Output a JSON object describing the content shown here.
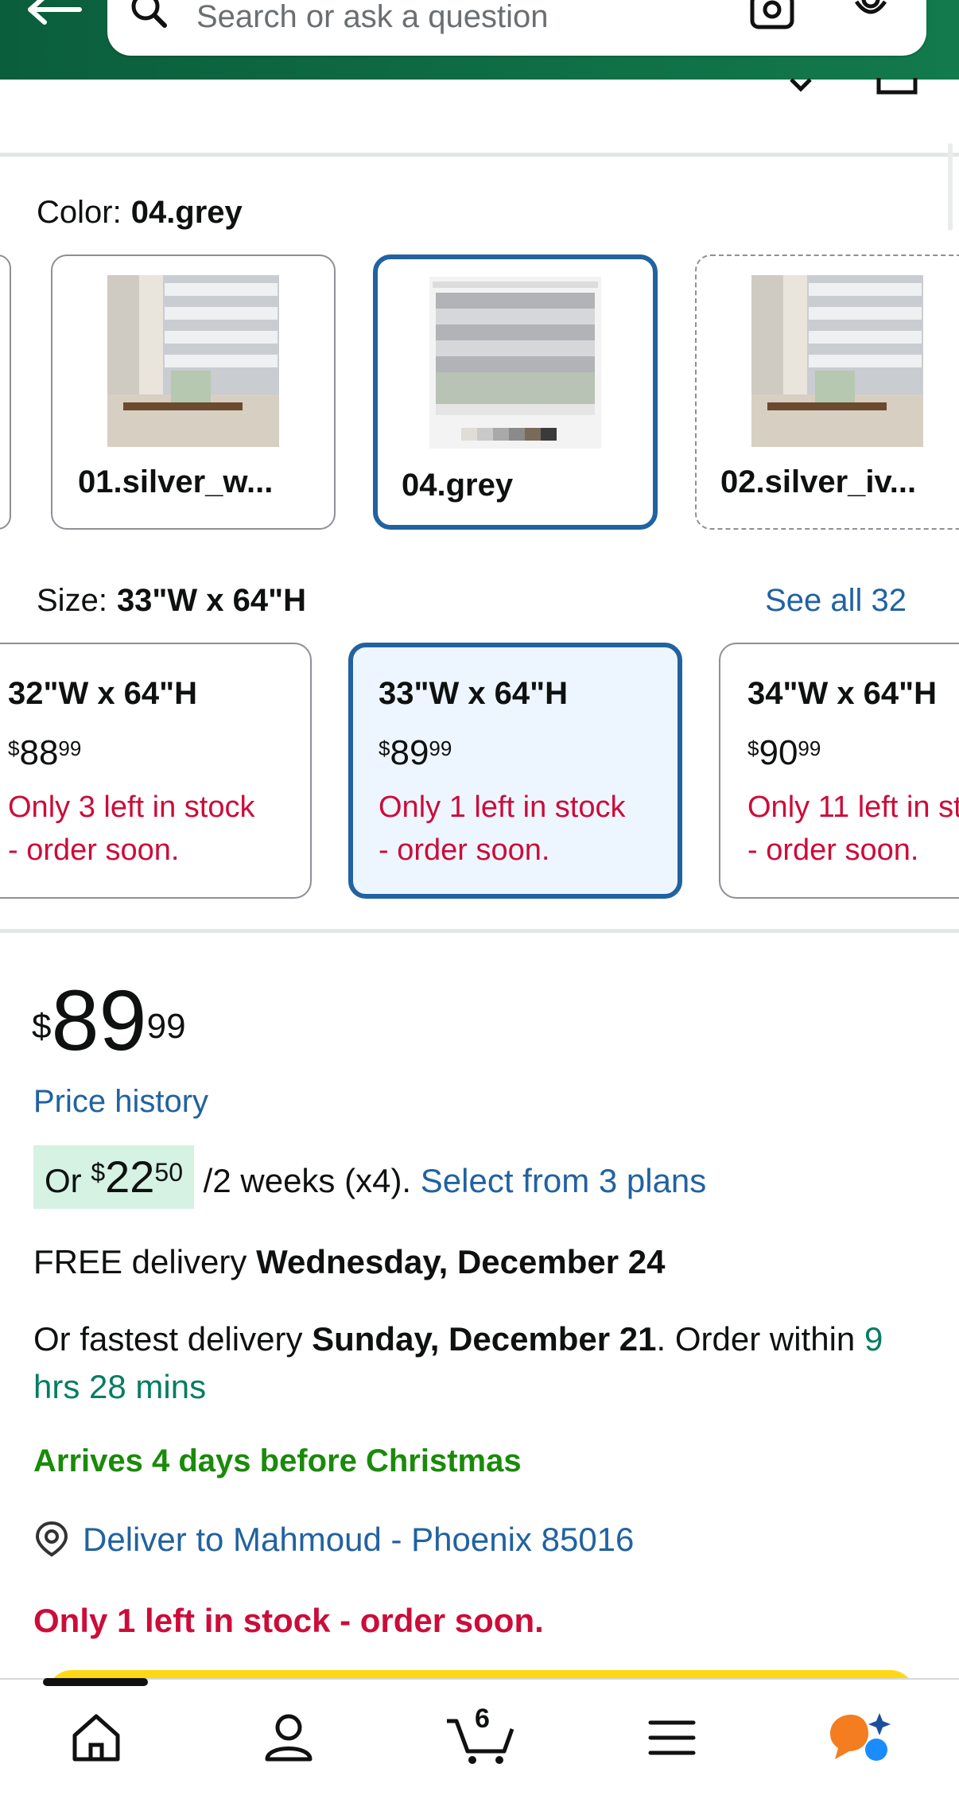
{
  "header": {
    "search_placeholder": "Search or ask a question"
  },
  "color": {
    "label": "Color:",
    "selected": "04.grey",
    "swatches": [
      {
        "name": "01.silver_w..."
      },
      {
        "name": "04.grey",
        "selected": true
      },
      {
        "name": "02.silver_iv..."
      }
    ]
  },
  "size": {
    "label": "Size:",
    "selected": "33\"W x 64\"H",
    "see_all": "See all 32",
    "options": [
      {
        "dim": "32\"W x 64\"H",
        "price_symbol": "$",
        "price_whole": "88",
        "price_cents": "99",
        "stock1": "Only 3 left in stock",
        "stock2": "- order soon."
      },
      {
        "dim": "33\"W x 64\"H",
        "price_symbol": "$",
        "price_whole": "89",
        "price_cents": "99",
        "stock1": "Only 1 left in stock",
        "stock2": "- order soon.",
        "selected": true
      },
      {
        "dim": "34\"W x 64\"H",
        "price_symbol": "$",
        "price_whole": "90",
        "price_cents": "99",
        "stock1": "Only 11 left in st",
        "stock2": "- order soon."
      }
    ]
  },
  "price": {
    "symbol": "$",
    "whole": "89",
    "cents": "99",
    "history_link": "Price history"
  },
  "plan": {
    "prefix": "Or ",
    "symbol": "$",
    "whole": "22",
    "cents": "50",
    "suffix": " /2 weeks (x4). ",
    "link": "Select from 3 plans"
  },
  "delivery": {
    "free_prefix": "FREE delivery ",
    "free_date": "Wednesday, December 24",
    "fast_prefix": "Or fastest delivery ",
    "fast_date": "Sunday, December 21",
    "fast_mid": ". Order within ",
    "fast_time": "9 hrs 28 mins",
    "arrives": "Arrives 4 days before Christmas",
    "deliver_to": "Deliver to Mahmoud - Phoenix 85016",
    "stock": "Only 1 left in stock - order soon."
  },
  "nav": {
    "cart_count": "6"
  },
  "colors": {
    "header": "#0b5e3c",
    "link": "#2162a1",
    "stock_red": "#cc0c39",
    "arrives_green": "#1a8a0a",
    "plan_badge": "#d5f2e3",
    "selected_border": "#2162a1"
  }
}
